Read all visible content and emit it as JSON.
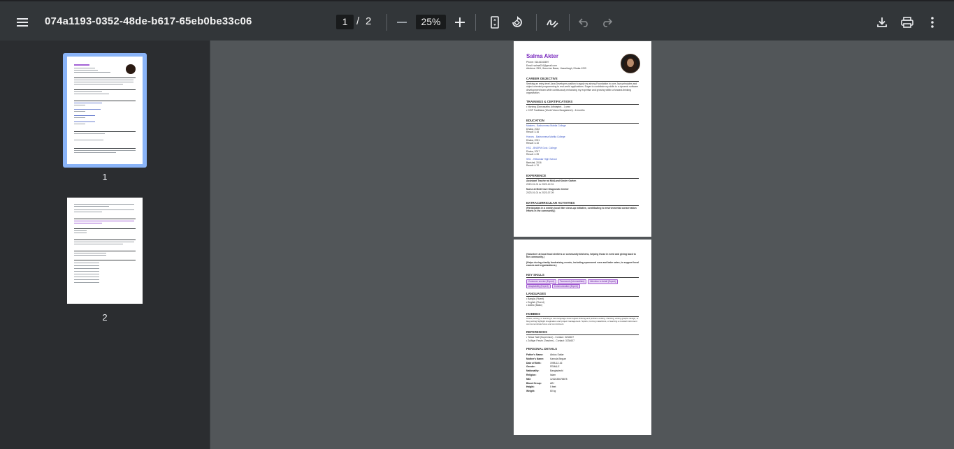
{
  "toolbar": {
    "title": "074a1193-0352-48de-b617-65eb0be33c06",
    "current_page": "1",
    "page_separator": "/",
    "total_pages": "2",
    "zoom": "25%",
    "icons": [
      "menu-icon",
      "zoom-out-icon",
      "zoom-in-icon",
      "fit-page-icon",
      "rotate-icon",
      "draw-icon",
      "undo-icon",
      "redo-icon",
      "download-icon",
      "print-icon",
      "more-icon"
    ]
  },
  "sidebar": {
    "thumbnails": [
      {
        "label": "1",
        "selected": true
      },
      {
        "label": "2",
        "selected": false
      }
    ]
  },
  "colors": {
    "toolbar_bg": "#323639",
    "viewer_bg": "#525659",
    "sidebar_bg": "#2b2d30",
    "selection": "#8ab4f8",
    "name_color": "#7b2cbf",
    "link_color": "#3a56c7"
  },
  "page1": {
    "name": "Salma Akter",
    "contact": [
      "Phone: 01444343697",
      "Email: salma034@gmail.com",
      "Address: 25/3, Jheochar Bazar, Hazaribagh, Dhaka-1209"
    ],
    "objective_heading": "CAREER OBJECTIVE",
    "objective_text": "Seeking an entry-level Java Developer position to apply my strong Foundation in core Java principles and object-oriented programming to real-world applications. Eager to contribute my skills to a dynamic software development team while continuously enhancing my expertise and growing within a forward-thinking organization.",
    "trainings_heading": "TRAININGS & CERTIFICATIONS",
    "trainings": [
      "• Nursing (Dancasathu Adhdapte) - 1 year",
      "• CEIP Facilitator (World Vision Bangladesh) - 6 months"
    ],
    "education_heading": "EDUCATION",
    "education": [
      {
        "title": "Masters - Badrunnesa Mahila College",
        "lines": [
          "Dhaka, 2022",
          "Result: 3.16"
        ]
      },
      {
        "title": "Honors - Badrunnesa Mahila College",
        "lines": [
          "Dhaka, 2021",
          "Result: 3.10"
        ]
      },
      {
        "title": "HSC - BNSPM Govt. College",
        "lines": [
          "Dhaka, 2017",
          "Result: 4.39"
        ]
      },
      {
        "title": "SSC - Hilbandar High School",
        "lines": [
          "Barishal, 2016",
          "Result: 4.70"
        ]
      }
    ],
    "experience_heading": "EXPERIENCE",
    "experience": [
      {
        "title": "Assistant Teacher at MidLand Kinder Garten",
        "dates": "2019-01-01 to 2020-12-31"
      },
      {
        "title": "Nurse at Medi Care Diagnostic Center",
        "dates": "2023-01-01 to 2023-07-09"
      }
    ],
    "extracurricular_heading": "EXTRACURRICULAR ACTIVITIES",
    "extracurricular_text": "(Participates in a weekly local litter clean-up initiative, contributing to environmental conservation efforts in the community.)"
  },
  "page2": {
    "volunteer_1": "(Volunteer at local food shelters or community kitchens, helping those in need and giving back to the community.)",
    "volunteer_2": "(Helps during charity fundraising events, including sponsored runs and bake sales, to support local causes and organizations.)",
    "skills_heading": "KEY SKILLS",
    "skills": [
      "Customer service (Expert)",
      "Teamwork (Intermediate)",
      "Attention to detail (Expert)",
      "Adaptability (Expert)",
      "Communication (Expert)"
    ],
    "languages_heading": "LANGUAGES",
    "languages": [
      "• Bangla (Fluent)",
      "• English (Fluent)",
      "• Arabic (Basic)"
    ],
    "hobbies_heading": "HOBBIES",
    "hobbies_text": "Chess, writing, or learning a new language show logical thinking and problem-solving. Painting, writing graphic design, or blog writing highlight imagination and project management. Sports, running marathons, or learning a musical instrument can demonstrate focus and commitment.",
    "references_heading": "REFERENCES",
    "references": [
      "• Tahsa Tasfi (Supervisor) - Contact: 3234607",
      "• Zulfiqar Parvin (Teacher) - Contact: 3234607"
    ],
    "personal_heading": "PERSONAL DETAILS",
    "personal": [
      {
        "k": "Father's Name:",
        "v": "Abdus Sattar"
      },
      {
        "k": "Mother's Name:",
        "v": "Kamola Begum"
      },
      {
        "k": "Date of Birth:",
        "v": "1998-12-16"
      },
      {
        "k": "Gender:",
        "v": "FEMALE"
      },
      {
        "k": "Nationality:",
        "v": "Bangladeshi"
      },
      {
        "k": "Religion:",
        "v": "Islam"
      },
      {
        "k": "NID:",
        "v": "1232435678878"
      },
      {
        "k": "Blood Group:",
        "v": "AB+"
      },
      {
        "k": "Height:",
        "v": "5 feet"
      },
      {
        "k": "Weight:",
        "v": "60 kg"
      }
    ]
  }
}
